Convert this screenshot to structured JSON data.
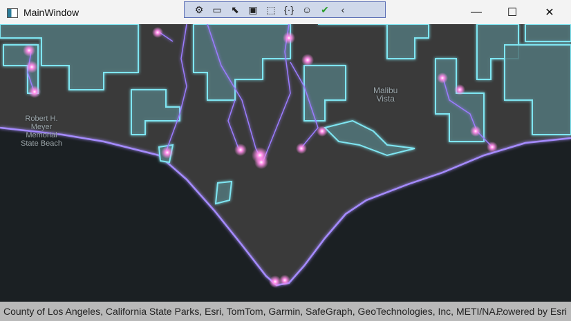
{
  "window": {
    "title": "MainWindow",
    "minimize": "—",
    "maximize": "☐",
    "close": "✕"
  },
  "toolbar": {
    "icons": [
      "live-visual-tree-icon",
      "video-icon",
      "select-element-icon",
      "display-layout-adorners-icon",
      "track-focus-icon",
      "binding-failures-icon",
      "accessibility-icon",
      "check-icon",
      "collapse-icon"
    ]
  },
  "map": {
    "labels": {
      "beach": "Robert H.\nMeyer\nMemorial\nState Beach",
      "vista": "Malibu\nVista"
    },
    "colors": {
      "land": "#3a3a3a",
      "ocean": "#1b2023",
      "parcel": "#4f6f72",
      "parcel_stroke": "#7fe6f2",
      "stream": "#9b7cff",
      "point": "#ff8ce8"
    }
  },
  "attribution": {
    "text": "County of Los Angeles, California State Parks, Esri, TomTom, Garmin, SafeGraph, GeoTechnologies, Inc, METI/NA...",
    "powered": "Powered by Esri"
  }
}
